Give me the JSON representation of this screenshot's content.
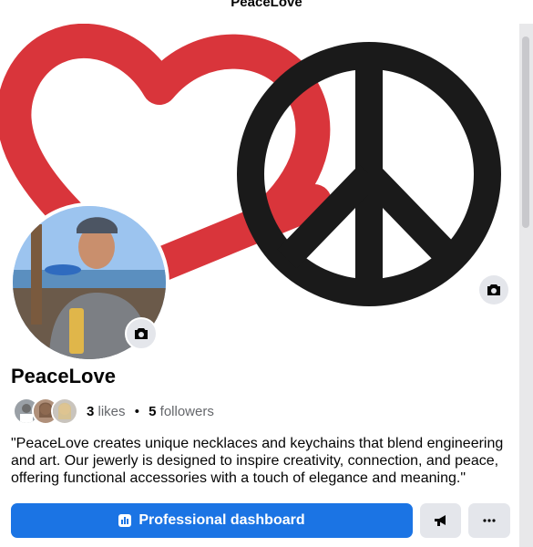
{
  "header": {
    "title": "PeaceLove"
  },
  "profile": {
    "name": "PeaceLove",
    "likes_count": "3",
    "likes_label": "likes",
    "separator": "•",
    "followers_count": "5",
    "followers_label": "followers",
    "bio": "\"PeaceLove creates unique necklaces and keychains that blend engineering and art. Our jewerly is designed to inspire creativity, connection, and peace, offering functional accessories with a touch of elegance and meaning.\""
  },
  "actions": {
    "dashboard_label": "Professional dashboard",
    "promote_icon": "megaphone-icon",
    "more_icon": "more-icon"
  },
  "colors": {
    "accent": "#1b74e4",
    "heart": "#d9353b",
    "peace": "#1a1a1a"
  }
}
